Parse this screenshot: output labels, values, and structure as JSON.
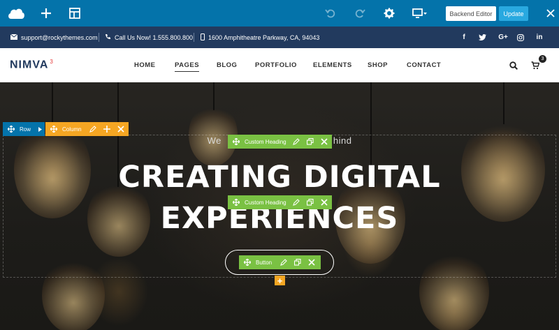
{
  "editor_toolbar": {
    "backend_editor_label": "Backend Editor",
    "update_label": "Update",
    "icons": [
      "cloud-icon",
      "plus-icon",
      "layout-icon",
      "undo-icon",
      "redo-icon",
      "gear-icon",
      "monitor-icon",
      "close-icon"
    ]
  },
  "info_bar": {
    "email": "support@rockythemes.com",
    "phone": "Call Us Now! 1.555.800.800",
    "address": "1600 Amphitheatre Parkway, CA, 94043",
    "social": [
      {
        "name": "facebook-icon",
        "glyph": "f"
      },
      {
        "name": "twitter-icon",
        "glyph": "t"
      },
      {
        "name": "google-plus-icon",
        "glyph": "G+"
      },
      {
        "name": "instagram-icon",
        "glyph": ""
      },
      {
        "name": "linkedin-icon",
        "glyph": "in"
      }
    ]
  },
  "nav": {
    "logo_text": "NIMVA",
    "logo_sup": "3",
    "items": [
      {
        "label": "HOME",
        "active": false
      },
      {
        "label": "PAGES",
        "active": true
      },
      {
        "label": "BLOG",
        "active": false
      },
      {
        "label": "PORTFOLIO",
        "active": false
      },
      {
        "label": "ELEMENTS",
        "active": false
      },
      {
        "label": "SHOP",
        "active": false
      },
      {
        "label": "CONTACT",
        "active": false
      }
    ],
    "cart_count": "3"
  },
  "hero": {
    "subheading_start": "We",
    "subheading_end": "hind",
    "title_line1": "CREATING DIGITAL",
    "title_line2": "EXPERIENCES"
  },
  "controls": {
    "row_label": "Row",
    "column_label": "Column",
    "heading_label_1": "Custom Heading",
    "heading_label_2": "Custom Heading",
    "button_label": "Button",
    "add_glyph": "+"
  },
  "colors": {
    "editor_bar": "#0473aa",
    "info_bar": "#223a5e",
    "row_control": "#0473aa",
    "column_control": "#f5a623",
    "element_control": "#7ac143",
    "update_button": "#29a9e0"
  }
}
